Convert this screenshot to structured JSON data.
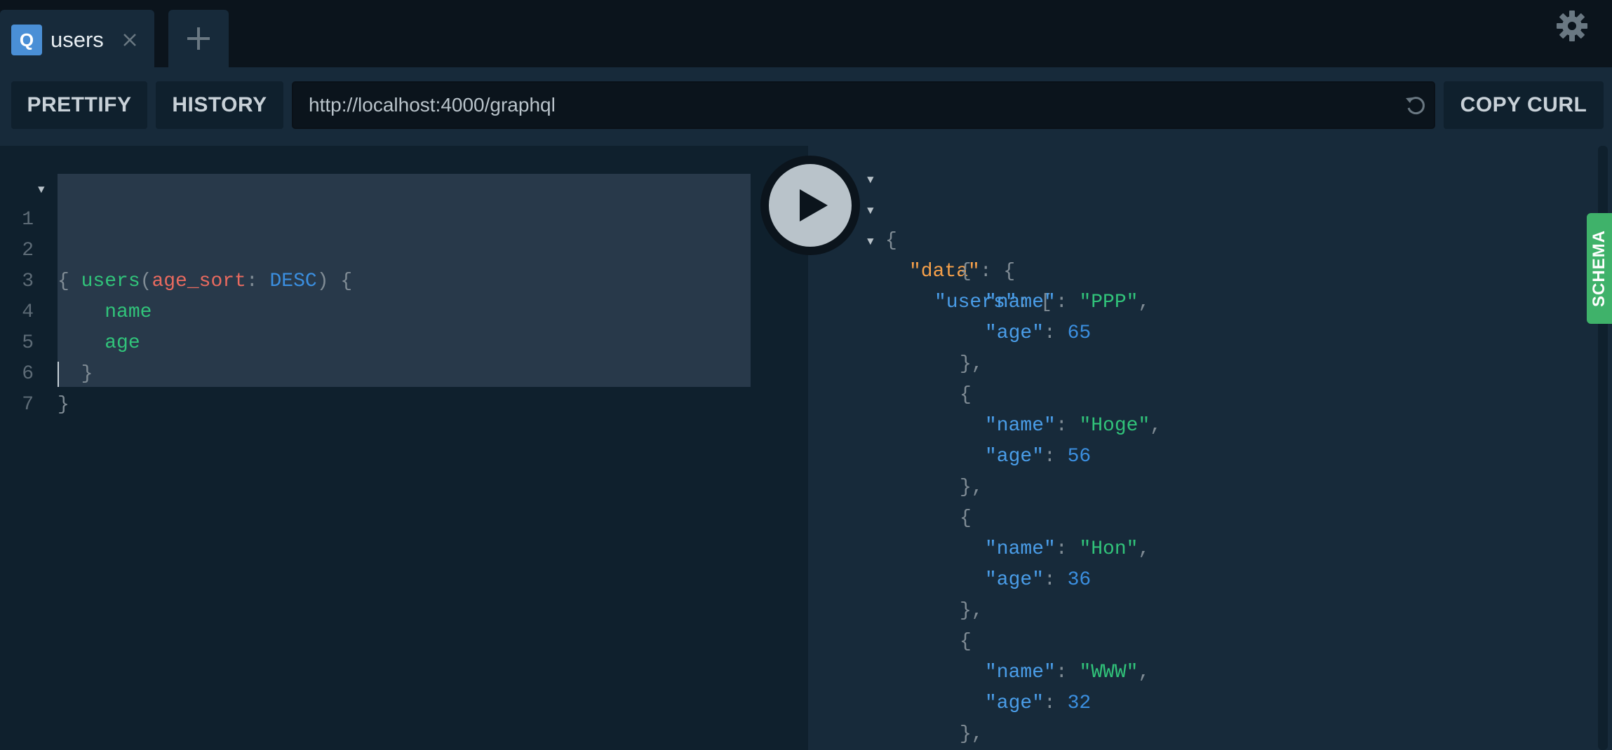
{
  "tabs": {
    "active": {
      "badge": "Q",
      "title": "users"
    }
  },
  "toolbar": {
    "prettify_label": "PRETTIFY",
    "history_label": "HISTORY",
    "endpoint_url": "http://localhost:4000/graphql",
    "copy_curl_label": "COPY CURL"
  },
  "editor": {
    "line_numbers": [
      "1",
      "2",
      "3",
      "4",
      "5",
      "6",
      "7"
    ],
    "tokens": {
      "open_brace": "{",
      "users": "users",
      "paren_open": "(",
      "arg_name": "age_sort",
      "colon": ":",
      "arg_value": "DESC",
      "paren_close": ")",
      "brace_open": "{",
      "field_name": "name",
      "field_age": "age",
      "brace_close_inner": "}",
      "brace_close_outer": "}"
    }
  },
  "result": {
    "data_key": "\"data\"",
    "users_key": "\"users\"",
    "name_key": "\"name\"",
    "age_key": "\"age\"",
    "users": [
      {
        "name": "\"PPP\"",
        "age": "65"
      },
      {
        "name": "\"Hoge\"",
        "age": "56"
      },
      {
        "name": "\"Hon\"",
        "age": "36"
      },
      {
        "name": "\"WWW\"",
        "age": "32"
      }
    ]
  },
  "schema_tab_label": "SCHEMA",
  "colors": {
    "tab_badge": "#4a8fd6",
    "schema_tab": "#3fb26a",
    "field_green": "#31c37a",
    "arg_red": "#e86a5f",
    "enum_blue": "#3b8fe0",
    "data_key_orange": "#f6a04a"
  },
  "icons": [
    "close-icon",
    "plus-icon",
    "gear-icon",
    "reload-icon",
    "play-icon",
    "fold-arrow-icon"
  ]
}
